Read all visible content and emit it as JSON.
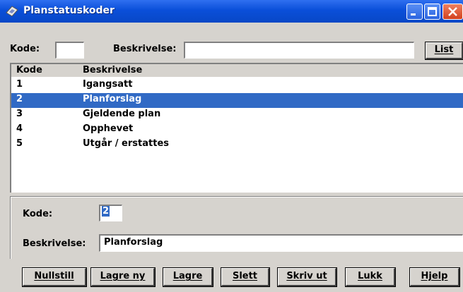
{
  "window": {
    "title": "Planstatuskoder"
  },
  "search": {
    "kode_label": "Kode:",
    "kode_value": "",
    "beskrivelse_label": "Beskrivelse:",
    "beskrivelse_value": "",
    "list_button": "List"
  },
  "list": {
    "columns": [
      "Kode",
      "Beskrivelse"
    ],
    "rows": [
      {
        "kode": "1",
        "beskrivelse": "Igangsatt"
      },
      {
        "kode": "2",
        "beskrivelse": "Planforslag"
      },
      {
        "kode": "3",
        "beskrivelse": "Gjeldende plan"
      },
      {
        "kode": "4",
        "beskrivelse": "Opphevet"
      },
      {
        "kode": "5",
        "beskrivelse": "Utgår / erstattes"
      }
    ],
    "selected_index": 1
  },
  "detail": {
    "kode_label": "Kode:",
    "kode_value": "2",
    "beskrivelse_label": "Beskrivelse:",
    "beskrivelse_value": "Planforslag"
  },
  "buttons": {
    "nullstill": "Nullstill",
    "lagre_ny": "Lagre ny",
    "lagre": "Lagre",
    "slett": "Slett",
    "skriv_ut": "Skriv ut",
    "lukk": "Lukk",
    "hjelp": "Hjelp"
  },
  "colors": {
    "titlebar": "#0a4fd9",
    "selection": "#316ac5",
    "face": "#d6d3ce"
  }
}
